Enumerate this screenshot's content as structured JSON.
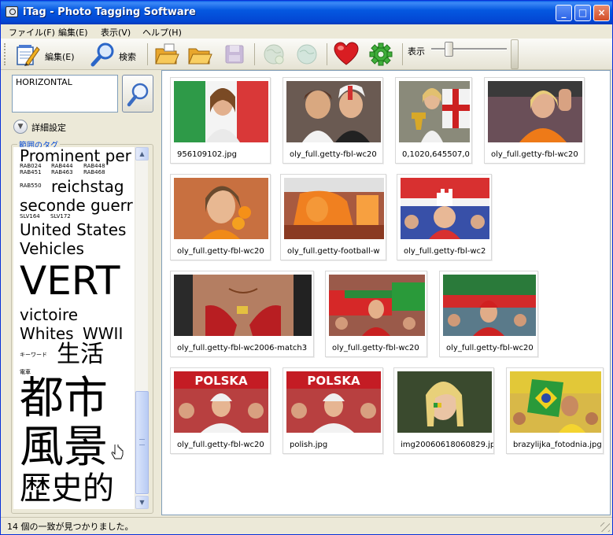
{
  "window": {
    "title": "iTag - Photo Tagging Software"
  },
  "menu": [
    {
      "label": "ファイル(F)"
    },
    {
      "label": "編集(E)"
    },
    {
      "label": "表示(V)"
    },
    {
      "label": "ヘルプ(H)"
    }
  ],
  "toolbar": {
    "edit_label": "編集(E)",
    "search_label": "検索",
    "view_label": "表示"
  },
  "search": {
    "value": "HORIZONTAL"
  },
  "advanced": {
    "label": "詳細設定"
  },
  "tags": {
    "legend": "範囲のタグ",
    "items": [
      {
        "text": "Prominent per",
        "size": 20
      },
      {
        "text": "RAB024",
        "size": 7
      },
      {
        "text": "RAB444",
        "size": 7
      },
      {
        "text": "RAB448",
        "size": 7
      },
      {
        "text": "RAB451",
        "size": 7
      },
      {
        "text": "RAB463",
        "size": 7
      },
      {
        "text": "RAB468",
        "size": 7
      },
      {
        "text": "RAB550",
        "size": 7
      },
      {
        "text": "reichstag",
        "size": 20
      },
      {
        "text": "seconde guerr",
        "size": 20
      },
      {
        "text": "SLV164",
        "size": 7
      },
      {
        "text": "SLV172",
        "size": 7
      },
      {
        "text": "United States",
        "size": 20
      },
      {
        "text": "Vehicles",
        "size": 20
      },
      {
        "text": "VERT",
        "size": 50
      },
      {
        "text": "victoire",
        "size": 20
      },
      {
        "text": "Whites",
        "size": 20
      },
      {
        "text": "WWII",
        "size": 20
      },
      {
        "text": "キーワード",
        "size": 7
      },
      {
        "text": "生活",
        "size": 30
      },
      {
        "text": "電車",
        "size": 7
      },
      {
        "text": "都市",
        "size": 56
      },
      {
        "text": "風景",
        "size": 56
      },
      {
        "text": "歴史的",
        "size": 40
      }
    ]
  },
  "results": [
    {
      "filename": "956109102.jpg"
    },
    {
      "filename": "oly_full.getty-fbl-wc20"
    },
    {
      "filename": "0,1020,645507,0"
    },
    {
      "filename": "oly_full.getty-fbl-wc20"
    },
    {
      "filename": "oly_full.getty-fbl-wc20"
    },
    {
      "filename": "oly_full.getty-football-w"
    },
    {
      "filename": "oly_full.getty-fbl-wc2"
    },
    {
      "filename": "oly_full.getty-fbl-wc2006-match3"
    },
    {
      "filename": "oly_full.getty-fbl-wc20"
    },
    {
      "filename": "oly_full.getty-fbl-wc20"
    },
    {
      "filename": "oly_full.getty-fbl-wc20"
    },
    {
      "filename": "polish.jpg"
    },
    {
      "filename": "img20060618060829.jp"
    },
    {
      "filename": "brazylijka_fotodnia.jpg"
    }
  ],
  "banner_text": "POLSKA",
  "status": {
    "text": "14 個の一致が見つかりました。"
  }
}
